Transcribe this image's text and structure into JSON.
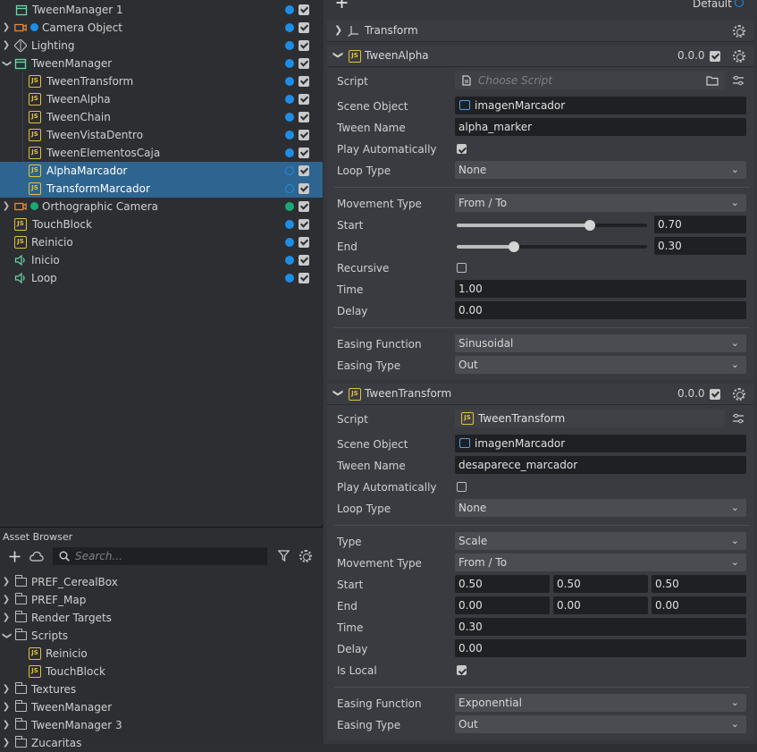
{
  "hierarchy": {
    "items": [
      {
        "label": "TweenManager 1"
      },
      {
        "label": "Camera Object"
      },
      {
        "label": "Lighting"
      },
      {
        "label": "TweenManager"
      },
      {
        "label": "TweenTransform"
      },
      {
        "label": "TweenAlpha"
      },
      {
        "label": "TweenChain"
      },
      {
        "label": "TweenVistaDentro"
      },
      {
        "label": "TweenElementosCaja"
      },
      {
        "label": "AlphaMarcador"
      },
      {
        "label": "TransformMarcador"
      },
      {
        "label": "Orthographic Camera"
      },
      {
        "label": "TouchBlock"
      },
      {
        "label": "Reinicio"
      },
      {
        "label": "Inicio"
      },
      {
        "label": "Loop"
      }
    ]
  },
  "asset_browser": {
    "title": "Asset Browser",
    "search_placeholder": "Search...",
    "items": [
      {
        "label": "PREF_CerealBox"
      },
      {
        "label": "PREF_Map"
      },
      {
        "label": "Render Targets"
      },
      {
        "label": "Scripts"
      },
      {
        "label": "Reinicio"
      },
      {
        "label": "TouchBlock"
      },
      {
        "label": "Textures"
      },
      {
        "label": "TweenManager"
      },
      {
        "label": "TweenManager 3"
      },
      {
        "label": "Zucaritas"
      }
    ]
  },
  "inspector": {
    "layer_label": "Default",
    "transform_title": "Transform",
    "icons": {
      "js": "JS"
    },
    "tween_alpha": {
      "title": "TweenAlpha",
      "version": "0.0.0",
      "labels": {
        "script": "Script",
        "scene_object": "Scene Object",
        "tween_name": "Tween Name",
        "play_auto": "Play Automatically",
        "loop_type": "Loop Type",
        "movement_type": "Movement Type",
        "start": "Start",
        "end": "End",
        "recursive": "Recursive",
        "time": "Time",
        "delay": "Delay",
        "easing_function": "Easing Function",
        "easing_type": "Easing Type"
      },
      "script_placeholder": "Choose Script",
      "scene_object": "imagenMarcador",
      "tween_name": "alpha_marker",
      "play_automatically": true,
      "loop_type": "None",
      "movement_type": "From / To",
      "start": "0.70",
      "start_fraction": 0.7,
      "end": "0.30",
      "end_fraction": 0.3,
      "recursive": false,
      "time": "1.00",
      "delay": "0.00",
      "easing_function": "Sinusoidal",
      "easing_type": "Out"
    },
    "tween_transform": {
      "title": "TweenTransform",
      "version": "0.0.0",
      "labels": {
        "script": "Script",
        "scene_object": "Scene Object",
        "tween_name": "Tween Name",
        "play_auto": "Play Automatically",
        "loop_type": "Loop Type",
        "type": "Type",
        "movement_type": "Movement Type",
        "start": "Start",
        "end": "End",
        "time": "Time",
        "delay": "Delay",
        "is_local": "Is Local",
        "easing_function": "Easing Function",
        "easing_type": "Easing Type"
      },
      "script": "TweenTransform",
      "scene_object": "imagenMarcador",
      "tween_name": "desaparece_marcador",
      "play_automatically": false,
      "loop_type": "None",
      "type": "Scale",
      "movement_type": "From / To",
      "start": [
        "0.50",
        "0.50",
        "0.50"
      ],
      "end": [
        "0.00",
        "0.00",
        "0.00"
      ],
      "time": "0.30",
      "delay": "0.00",
      "is_local": true,
      "easing_function": "Exponential",
      "easing_type": "Out"
    }
  }
}
